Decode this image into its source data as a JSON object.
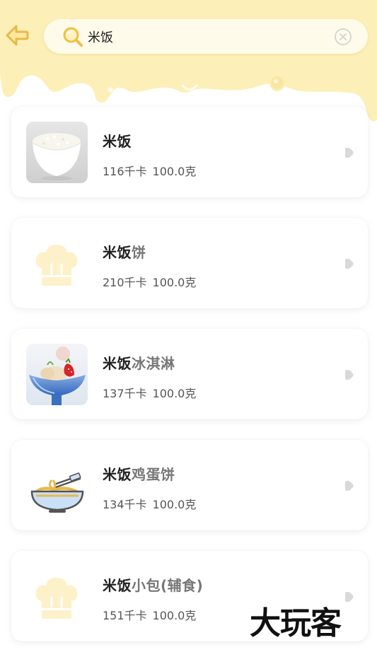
{
  "search": {
    "query": "米饭"
  },
  "results": [
    {
      "match": "米饭",
      "rest": "",
      "calories": "116千卡",
      "weight": "100.0克",
      "thumb": "rice-bowl"
    },
    {
      "match": "米饭",
      "rest": "饼",
      "calories": "210千卡",
      "weight": "100.0克",
      "thumb": "chef-hat-placeholder"
    },
    {
      "match": "米饭",
      "rest": "冰淇淋",
      "calories": "137千卡",
      "weight": "100.0克",
      "thumb": "ice-cream-bowl"
    },
    {
      "match": "米饭",
      "rest": "鸡蛋饼",
      "calories": "134千卡",
      "weight": "100.0克",
      "thumb": "noodle-bowl"
    },
    {
      "match": "米饭",
      "rest": "小包(辅食)",
      "calories": "151千卡",
      "weight": "100.0克",
      "thumb": "chef-hat-placeholder"
    }
  ],
  "watermark": "大玩客",
  "colors": {
    "banner": "#fcefb8",
    "accent": "#f6d56a",
    "card_bg": "#ffffff",
    "arrow": "#d8d8d8"
  }
}
